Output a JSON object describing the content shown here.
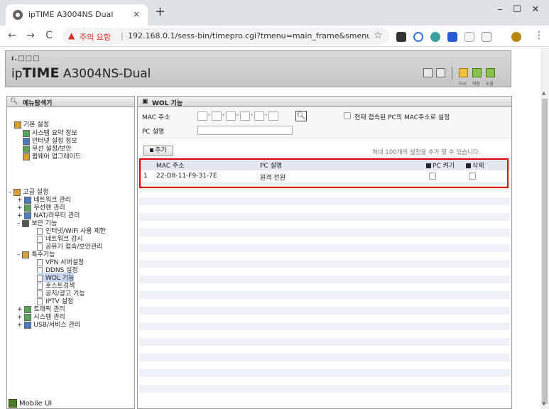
{
  "browser": {
    "tab_title": "ipTIME A3004NS Dual",
    "tab_close": "×",
    "new_tab": "+",
    "window_min": "–",
    "window_max": "☐",
    "window_close": "✕",
    "back": "←",
    "forward": "→",
    "reload": "C",
    "security_warning": "주의 요함",
    "separator": "|",
    "url": "192.168.0.1/sess-bin/timepro.cgi?tmenu=main_frame&smenu=...",
    "star": "☆",
    "menu": "⋮"
  },
  "header": {
    "brand_small": "ı.□□□",
    "brand_prefix": "ip",
    "brand_bold": "TIME",
    "model": "A3004NS-Dual",
    "labels": [
      "다시",
      "저장",
      "도움"
    ]
  },
  "sidebar": {
    "title": "메뉴탐색기",
    "basic": {
      "label": "기본 설정",
      "items": [
        "시스템 요약 정보",
        "인터넷 설정 정보",
        "무선 설정/보안",
        "펌웨어 업그레이드"
      ]
    },
    "advanced": {
      "label": "고급 설정",
      "network": "네트워크 관리",
      "wireless": "무선랜 관리",
      "nat": "NAT/라우터 관리",
      "security": {
        "label": "보안 기능",
        "items": [
          "인터넷/WiFi 사용 제한",
          "네트워크 감시",
          "공유기 접속/보안관리"
        ]
      },
      "special": {
        "label": "특수기능",
        "items": [
          "VPN 서버설정",
          "DDNS 설정",
          "WOL 기능",
          "호스트검색",
          "공지/광고 기능",
          "IPTV 설정"
        ]
      },
      "traffic": "트래픽 관리",
      "system": "시스템 관리",
      "usb": "USB/서비스 관리"
    },
    "mobile": "Mobile UI",
    "expand": "+",
    "collapse": "–"
  },
  "content": {
    "title": "WOL 기능",
    "form": {
      "mac_label": "MAC 주소",
      "pc_label": "PC 설명",
      "mac_values": [
        "",
        "",
        "",
        "",
        "",
        ""
      ],
      "pc_value": "",
      "use_current_pc": "현재 접속된 PC의 MAC주소로 설정",
      "search_icon": "🔍"
    },
    "add_button": "추가",
    "max_note": "최대 100개의 설정을 추가 할 수 있습니다.",
    "table": {
      "headers": [
        "MAC 주소",
        "PC 설명",
        "PC 켜기",
        "삭제"
      ],
      "rows": [
        {
          "index": "1",
          "mac": "22-D8-11-F9-31-7E",
          "desc": "원격 전원"
        }
      ]
    }
  },
  "colors": {
    "highlight_box": "#e00000",
    "warning": "#d93025",
    "selected_menu": "#c8d7f0"
  }
}
